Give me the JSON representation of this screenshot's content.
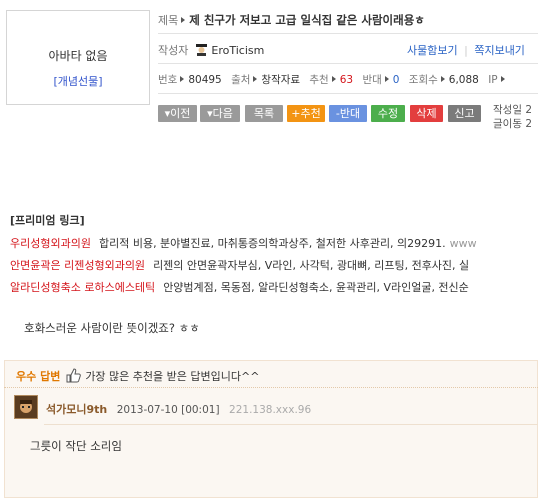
{
  "avatar": {
    "name": "아바타 없음",
    "gift": "[개념선물]"
  },
  "post": {
    "title_label": "제목",
    "title": "제 친구가 저보고 고급 일식집 같은 사람이래용ㅎ",
    "author_label": "작성자",
    "author": "EroTicism",
    "gift_view": "사물함보기",
    "send_note": "쪽지보내기",
    "number_label": "번호",
    "number": "80495",
    "source_label": "출처",
    "source": "창작자료",
    "recommend_label": "추천",
    "recommend": "63",
    "oppose_label": "반대",
    "oppose": "0",
    "views_label": "조회수",
    "views": "6,088",
    "ip_label": "IP",
    "date_label": "작성일 2",
    "length_label": "글이동 2"
  },
  "buttons": {
    "prev": "▾이전",
    "next": "▾다음",
    "list": "목록",
    "recommend": "+추천",
    "oppose": "-반대",
    "edit": "수정",
    "delete": "삭제",
    "report": "신고"
  },
  "premium": {
    "heading": "[프리미엄 링크]",
    "ads": [
      {
        "title": "우리성형외과의원",
        "desc": "합리적 비용, 분야별진료, 마취통증의학과상주, 철저한 사후관리, 의29291.",
        "url": "www"
      },
      {
        "title": "안면윤곽은 리젠성형외과의원",
        "desc": "리젠의 안면윤곽자부심, V라인, 사각턱, 광대뼈, 리프팅, 전후사진, 실",
        "url": ""
      },
      {
        "title": "알라딘성형축소 로하스에스테틱",
        "desc": "안양범계점, 목동점, 알라딘성형축소, 윤곽관리, V라인얼굴, 전신순",
        "url": ""
      }
    ]
  },
  "body_text": "호화스러운 사람이란 뜻이겠죠? ㅎㅎ",
  "best_answer": {
    "badge": "우수 답변",
    "desc": "가장 많은 추천을 받은 답변입니다^^",
    "user": "석가모니9th",
    "date": "2013-07-10 [00:01]",
    "ip": "221.138.xxx.96",
    "text": "그릇이 작단 소리임"
  }
}
